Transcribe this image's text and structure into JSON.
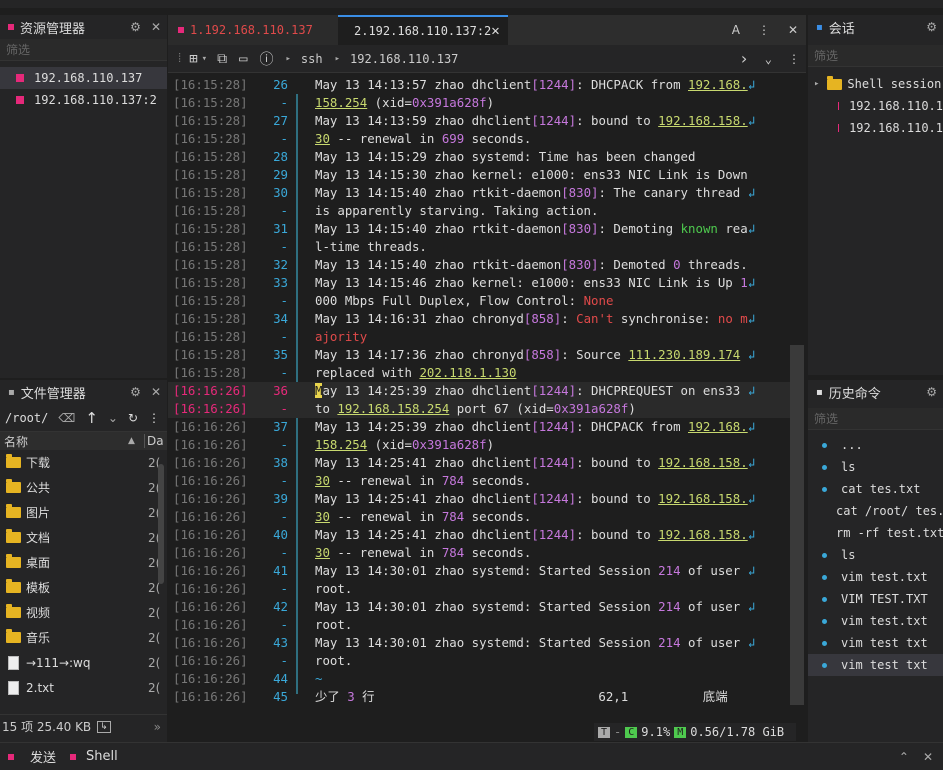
{
  "left_panel": {
    "title": "资源管理器",
    "filter_placeholder": "筛选",
    "sessions": [
      {
        "label": "192.168.110.137"
      },
      {
        "label": "192.168.110.137:2"
      }
    ]
  },
  "file_manager": {
    "title": "文件管理器",
    "path": "/root/",
    "col_name": "名称",
    "col_date": "Da",
    "items": [
      {
        "name": "下载",
        "type": "folder",
        "date": "2("
      },
      {
        "name": "公共",
        "type": "folder",
        "date": "2("
      },
      {
        "name": "图片",
        "type": "folder",
        "date": "2("
      },
      {
        "name": "文档",
        "type": "folder",
        "date": "2("
      },
      {
        "name": "桌面",
        "type": "folder",
        "date": "2("
      },
      {
        "name": "模板",
        "type": "folder",
        "date": "2("
      },
      {
        "name": "视频",
        "type": "folder",
        "date": "2("
      },
      {
        "name": "音乐",
        "type": "folder",
        "date": "2("
      },
      {
        "name": "→111→:wq",
        "type": "file",
        "date": "2("
      },
      {
        "name": "2.txt",
        "type": "file",
        "date": "2("
      }
    ],
    "footer": "15 项 25.40 KB"
  },
  "tabs": [
    {
      "label": "1.192.168.110.137"
    },
    {
      "label": "2.192.168.110.137:2"
    }
  ],
  "toolbar": {
    "protocol": "ssh",
    "host": "192.168.110.137"
  },
  "terminal": {
    "lines": [
      {
        "ts": "[16:15:28]",
        "ln": "26",
        "html": "May 13 14:13:57 zhao dhclient<span class='m'>[1244]</span>: DHCPACK from <span class='u'>192.168.</span><span class='c'>↲</span>"
      },
      {
        "ts": "[16:15:28]",
        "ln": "-",
        "html": "<span class='u'>158.254</span> (xid=<span class='m'>0x391a628f</span>)"
      },
      {
        "ts": "[16:15:28]",
        "ln": "27",
        "html": "May 13 14:13:59 zhao dhclient<span class='m'>[1244]</span>: bound to <span class='u'>192.168.158.</span><span class='c'>↲</span>"
      },
      {
        "ts": "[16:15:28]",
        "ln": "-",
        "html": "<span class='u'>30</span> -- renewal in <span class='m'>699</span> seconds."
      },
      {
        "ts": "[16:15:28]",
        "ln": "28",
        "html": "May 13 14:15:29 zhao systemd: Time has been changed"
      },
      {
        "ts": "[16:15:28]",
        "ln": "29",
        "html": "May 13 14:15:30 zhao kernel: e1000: ens33 NIC Link is Down"
      },
      {
        "ts": "[16:15:28]",
        "ln": "30",
        "html": "May 13 14:15:40 zhao rtkit-daemon<span class='m'>[830]</span>: The canary thread <span class='c'>↲</span>"
      },
      {
        "ts": "[16:15:28]",
        "ln": "-",
        "html": "is apparently starving. Taking action."
      },
      {
        "ts": "[16:15:28]",
        "ln": "31",
        "html": "May 13 14:15:40 zhao rtkit-daemon<span class='m'>[830]</span>: Demoting <span class='g'>known</span> rea<span class='c'>↲</span>"
      },
      {
        "ts": "[16:15:28]",
        "ln": "-",
        "html": "l-time threads."
      },
      {
        "ts": "[16:15:28]",
        "ln": "32",
        "html": "May 13 14:15:40 zhao rtkit-daemon<span class='m'>[830]</span>: Demoted <span class='m'>0</span> threads."
      },
      {
        "ts": "[16:15:28]",
        "ln": "33",
        "html": "May 13 14:15:46 zhao kernel: e1000: ens33 NIC Link is Up <span class='m'>1</span><span class='c'>↲</span>"
      },
      {
        "ts": "[16:15:28]",
        "ln": "-",
        "html": "000 Mbps Full Duplex, Flow Control: <span class='r'>None</span>"
      },
      {
        "ts": "[16:15:28]",
        "ln": "34",
        "html": "May 13 14:16:31 zhao chronyd<span class='m'>[858]</span>: <span class='r'>Can't</span> synchronise: <span class='r'>no m</span><span class='c'>↲</span>"
      },
      {
        "ts": "[16:15:28]",
        "ln": "-",
        "html": "<span class='r'>ajority</span>"
      },
      {
        "ts": "[16:15:28]",
        "ln": "35",
        "html": "May 13 14:17:36 zhao chronyd<span class='m'>[858]</span>: Source <span class='u'>111.230.189.174</span> <span class='c'>↲</span>"
      },
      {
        "ts": "[16:15:28]",
        "ln": "-",
        "html": "replaced with <span class='u'>202.118.1.130</span>"
      },
      {
        "ts": "[16:16:26]",
        "ln": "36",
        "html": "<span style='background:#e8d44d;color:#1e1e1e'>M</span>ay 13 14:25:39 zhao dhclient<span class='m'>[1244]</span>: DHCPREQUEST on ens33 <span class='c'>↲</span>",
        "hl": true
      },
      {
        "ts": "[16:16:26]",
        "ln": "-",
        "html": "to <span class='u'>192.168.158.254</span> port 67 (xid=<span class='m'>0x391a628f</span>)",
        "hl": true
      },
      {
        "ts": "[16:16:26]",
        "ln": "37",
        "html": "May 13 14:25:39 zhao dhclient<span class='m'>[1244]</span>: DHCPACK from <span class='u'>192.168.</span><span class='c'>↲</span>"
      },
      {
        "ts": "[16:16:26]",
        "ln": "-",
        "html": "<span class='u'>158.254</span> (xid=<span class='m'>0x391a628f</span>)"
      },
      {
        "ts": "[16:16:26]",
        "ln": "38",
        "html": "May 13 14:25:41 zhao dhclient<span class='m'>[1244]</span>: bound to <span class='u'>192.168.158.</span><span class='c'>↲</span>"
      },
      {
        "ts": "[16:16:26]",
        "ln": "-",
        "html": "<span class='u'>30</span> -- renewal in <span class='m'>784</span> seconds."
      },
      {
        "ts": "[16:16:26]",
        "ln": "39",
        "html": "May 13 14:25:41 zhao dhclient<span class='m'>[1244]</span>: bound to <span class='u'>192.168.158.</span><span class='c'>↲</span>"
      },
      {
        "ts": "[16:16:26]",
        "ln": "-",
        "html": "<span class='u'>30</span> -- renewal in <span class='m'>784</span> seconds."
      },
      {
        "ts": "[16:16:26]",
        "ln": "40",
        "html": "May 13 14:25:41 zhao dhclient<span class='m'>[1244]</span>: bound to <span class='u'>192.168.158.</span><span class='c'>↲</span>"
      },
      {
        "ts": "[16:16:26]",
        "ln": "-",
        "html": "<span class='u'>30</span> -- renewal in <span class='m'>784</span> seconds."
      },
      {
        "ts": "[16:16:26]",
        "ln": "41",
        "html": "May 13 14:30:01 zhao systemd: Started Session <span class='m'>214</span> of user <span class='c'>↲</span>"
      },
      {
        "ts": "[16:16:26]",
        "ln": "-",
        "html": "root."
      },
      {
        "ts": "[16:16:26]",
        "ln": "42",
        "html": "May 13 14:30:01 zhao systemd: Started Session <span class='m'>214</span> of user <span class='c'>↲</span>"
      },
      {
        "ts": "[16:16:26]",
        "ln": "-",
        "html": "root."
      },
      {
        "ts": "[16:16:26]",
        "ln": "43",
        "html": "May 13 14:30:01 zhao systemd: Started Session <span class='m'>214</span> of user <span class='c'>↲</span>"
      },
      {
        "ts": "[16:16:26]",
        "ln": "-",
        "html": "root."
      },
      {
        "ts": "[16:16:26]",
        "ln": "44",
        "html": "<span class='c'>~</span>"
      },
      {
        "ts": "[16:16:26]",
        "ln": "45",
        "html": "少了 <span class='m'>3</span> 行                              62,1          底端"
      }
    ]
  },
  "status": {
    "t": "T",
    "cpu_label": "C",
    "cpu": "9.1%",
    "mem_label": "M",
    "mem": "0.56/1.78 GiB"
  },
  "session_panel": {
    "title": "会话",
    "filter_placeholder": "筛选",
    "group": "Shell session",
    "items": [
      "192.168.110.1",
      "192.168.110.1"
    ]
  },
  "history_panel": {
    "title": "历史命令",
    "filter_placeholder": "筛选",
    "items": [
      "...",
      "ls",
      "cat tes.txt",
      "cat /root/ tes.",
      "rm -rf test.txt",
      "ls",
      "vim test.txt",
      "VIM TEST.TXT",
      "vim test.txt",
      "vim test txt",
      "vim test txt"
    ]
  },
  "bottom_tabs": {
    "send": "发送",
    "shell": "Shell"
  }
}
